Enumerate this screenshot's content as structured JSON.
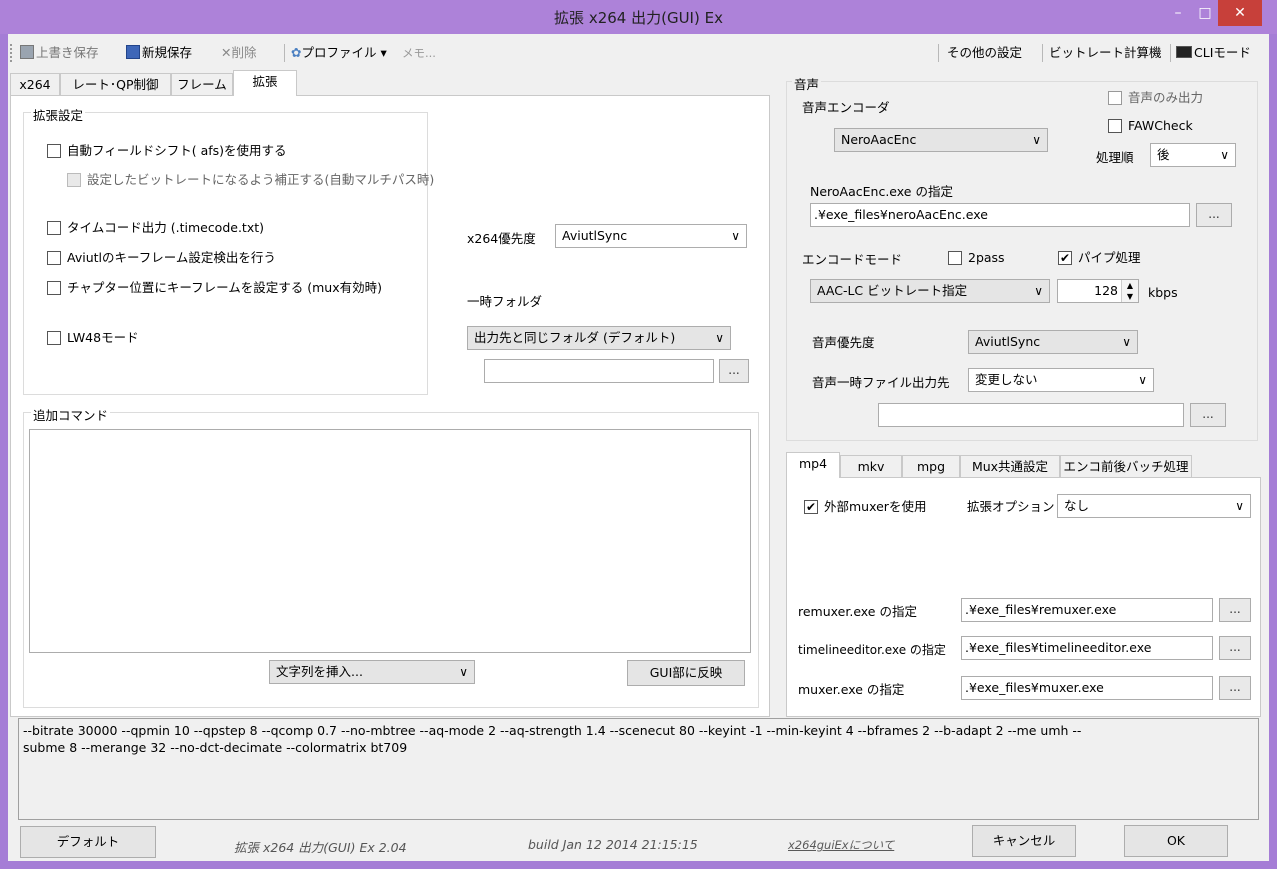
{
  "window": {
    "title": "拡張 x264 出力(GUI) Ex",
    "minimize": "–",
    "maximize": "□",
    "close": "✕"
  },
  "toolbar": {
    "overwrite_save": "上書き保存",
    "new_save": "新規保存",
    "delete": "削除",
    "profile": "プロファイル ▾",
    "memo": "メモ...",
    "other_settings": "その他の設定",
    "bitrate_calc": "ビットレート計算機",
    "cli_mode": "CLIモード"
  },
  "tabs": {
    "x264": "x264",
    "rate": "レート･QP制御",
    "frame": "フレーム",
    "ext": "拡張"
  },
  "ext": {
    "group_title": "拡張設定",
    "afs": "自動フィールドシフト( afs)を使用する",
    "afs_correct": "設定したビットレートになるよう補正する(自動マルチパス時)",
    "timecode": "タイムコード出力 (.timecode.txt)",
    "keyframe_detect": "Aviutlのキーフレーム設定検出を行う",
    "chapter_keyframe": "チャプター位置にキーフレームを設定する (mux有効時)",
    "lw48": "LW48モード",
    "x264_priority_label": "x264優先度",
    "x264_priority_value": "AviutlSync",
    "temp_folder_label": "一時フォルダ",
    "temp_folder_value": "出力先と同じフォルダ (デフォルト)",
    "temp_folder_path": "",
    "browse": "..."
  },
  "add_command": {
    "title": "追加コマンド",
    "text": "",
    "insert_combo": "文字列を挿入...",
    "reflect_btn": "GUI部に反映"
  },
  "audio": {
    "group_title": "音声",
    "encoder_label": "音声エンコーダ",
    "encoder_value": "NeroAacEnc",
    "audio_only": "音声のみ出力",
    "faw_check": "FAWCheck",
    "order_label": "処理順",
    "order_value": "後",
    "exe_label": "NeroAacEnc.exe の指定",
    "exe_path": ".¥exe_files¥neroAacEnc.exe",
    "browse": "...",
    "encode_mode_label": "エンコードモード",
    "twopass": "2pass",
    "pipe": "パイプ処理",
    "pipe_checked": "✔",
    "mode_value": "AAC-LC ビットレート指定",
    "bitrate": "128",
    "kbps": "kbps",
    "priority_label": "音声優先度",
    "priority_value": "AviutlSync",
    "temp_out_label": "音声一時ファイル出力先",
    "temp_out_value": "変更しない",
    "temp_out_path": ""
  },
  "mux_tabs": {
    "mp4": "mp4",
    "mkv": "mkv",
    "mpg": "mpg",
    "common": "Mux共通設定",
    "batch": "エンコ前後バッチ処理"
  },
  "mp4": {
    "use_external": "外部muxerを使用",
    "use_external_checked": "✔",
    "ext_option_label": "拡張オプション",
    "ext_option_value": "なし",
    "remuxer_label": "remuxer.exe の指定",
    "remuxer_path": ".¥exe_files¥remuxer.exe",
    "timeline_label": "timelineeditor.exe の指定",
    "timeline_path": ".¥exe_files¥timelineeditor.exe",
    "muxer_label": "muxer.exe の指定",
    "muxer_path": ".¥exe_files¥muxer.exe",
    "browse": "..."
  },
  "cmdline": {
    "line1": "--bitrate 30000 --qpmin 10 --qpstep 8 --qcomp 0.7 --no-mbtree --aq-mode 2 --aq-strength 1.4 --scenecut 80 --keyint -1 --min-keyint 4 --bframes 2 --b-adapt 2 --me umh --",
    "line2": "subme 8 --merange 32 --no-dct-decimate --colormatrix bt709"
  },
  "footer": {
    "default_btn": "デフォルト",
    "version": "拡張 x264 出力(GUI) Ex 2.04",
    "build": "build Jan 12 2014 21:15:15",
    "about_link": "x264guiExについて",
    "cancel_btn": "キャンセル",
    "ok_btn": "OK"
  },
  "colors": {
    "title_bar": "#ad82d9",
    "close_button": "#c7403a",
    "link": "#5a5a5a"
  }
}
